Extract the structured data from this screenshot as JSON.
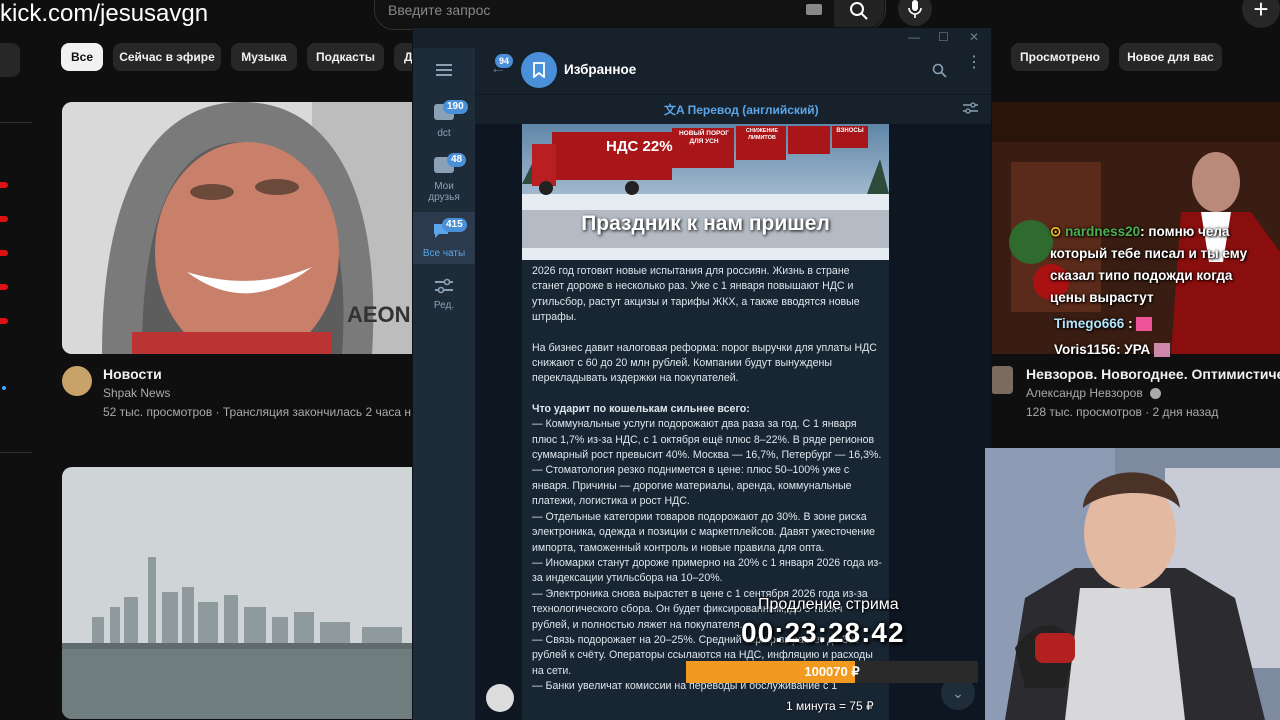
{
  "browser": {
    "url": "kick.com/jesusavgn"
  },
  "youtube": {
    "search_placeholder": "Введите запрос",
    "chips": [
      "Все",
      "Сейчас в эфире",
      "Музыка",
      "Подкасты",
      "Д",
      "Просмотрено",
      "Новое для вас"
    ],
    "videos": [
      {
        "title": "Новости",
        "channel": "Shpak News",
        "stats": "52 тыс. просмотров · Трансляция закончилась 2 часа н"
      },
      {
        "title": "Невзоров. Новогоднее. Оптимистическ",
        "channel": "Александр Невзоров",
        "stats": "128 тыс. просмотров · 2 дня назад"
      }
    ],
    "thumb_text": "AEON"
  },
  "telegram": {
    "back_badge": "94",
    "chat_title": "Избранное",
    "translate_bar": "Перевод (английский)",
    "folders": [
      {
        "label": "dct",
        "badge": "190"
      },
      {
        "label": "Мои друзья",
        "badge": "48"
      },
      {
        "label": "Все чаты",
        "badge": "415"
      },
      {
        "label": "Ред.",
        "badge": ""
      }
    ],
    "banner": {
      "truck1": "НДС 22%",
      "truck2": "НОВЫЙ ПОРОГ ДЛЯ УСН",
      "truck3": "СНИЖЕНИЕ ЛИМИТОВ",
      "truck4": "ВЗНОСЫ",
      "headline": "Праздник к нам пришел"
    },
    "message": {
      "p1": "2026 год готовит новые испытания для россиян. Жизнь в стране станет дороже в несколько раз. Уже с 1 января повышают НДС и утильсбор, растут акцизы и тарифы ЖКХ, а также вводятся новые штрафы.",
      "p2": "На бизнес давит налоговая реформа: порог выручки для уплаты НДС снижают с 60 до 20 млн рублей. Компании будут вынуждены перекладывать издержки на покупателей.",
      "heading": "Что ударит по кошелькам сильнее всего:",
      "l1": "— Коммунальные услуги подорожают два раза за год. С 1 января плюс 1,7% из-за НДС, с 1 октября ещё плюс 8–22%. В ряде регионов суммарный рост превысит 40%. Москва — 16,7%, Петербург — 16,3%.",
      "l2": "— Стоматология резко поднимется в цене: плюс 50–100% уже с января. Причины — дорогие материалы, аренда, коммунальные платежи, логистика и рост НДС.",
      "l3": "— Отдельные категории товаров подорожают до 30%. В зоне риска электроника, одежда и позиции с маркетплейсов. Давят ужесточение импорта, таможенный контроль и новые правила для опта.",
      "l4": "— Иномарки станут дороже примерно на 20% с 1 января 2026 года из-за индексации утильсбора на 10–20%.",
      "l5": "— Электроника снова вырастет в цене с 1 сентября 2026 года из-за технологического сбора. Он будет фиксированным, до 5 тысяч рублей, и полностью ляжет на покупателя.",
      "l6": "— Связь подорожает на 20–25%. Средний тариф вырастет до 300 рублей к счёту. Операторы ссылаются на НДС, инфляцию и расходы на сети.",
      "l7": "— Банки увеличат комиссии на переводы и обслуживание с 1"
    }
  },
  "stream": {
    "title": "Продление стрима",
    "timer": "00:23:28:42",
    "amount": "100070 ₽",
    "progress": 0.58,
    "rate": "1 минута = 75 ₽",
    "chat": [
      {
        "user": "nardness20",
        "text": "помню чела"
      },
      {
        "user": "",
        "text": "который тебе писал и ты ему"
      },
      {
        "user": "",
        "text": "сказал типо подожди когда"
      },
      {
        "user": "",
        "text": "цены вырастут"
      },
      {
        "user": "Timego666",
        "text": ":"
      },
      {
        "user": "Voris1156",
        "text": ": УРА"
      }
    ]
  },
  "colors": {
    "yt_bg": "#0f0f0f",
    "tg_bg": "#17212b",
    "tg_accent": "#4a90d9",
    "progress": "#f29a1f"
  }
}
